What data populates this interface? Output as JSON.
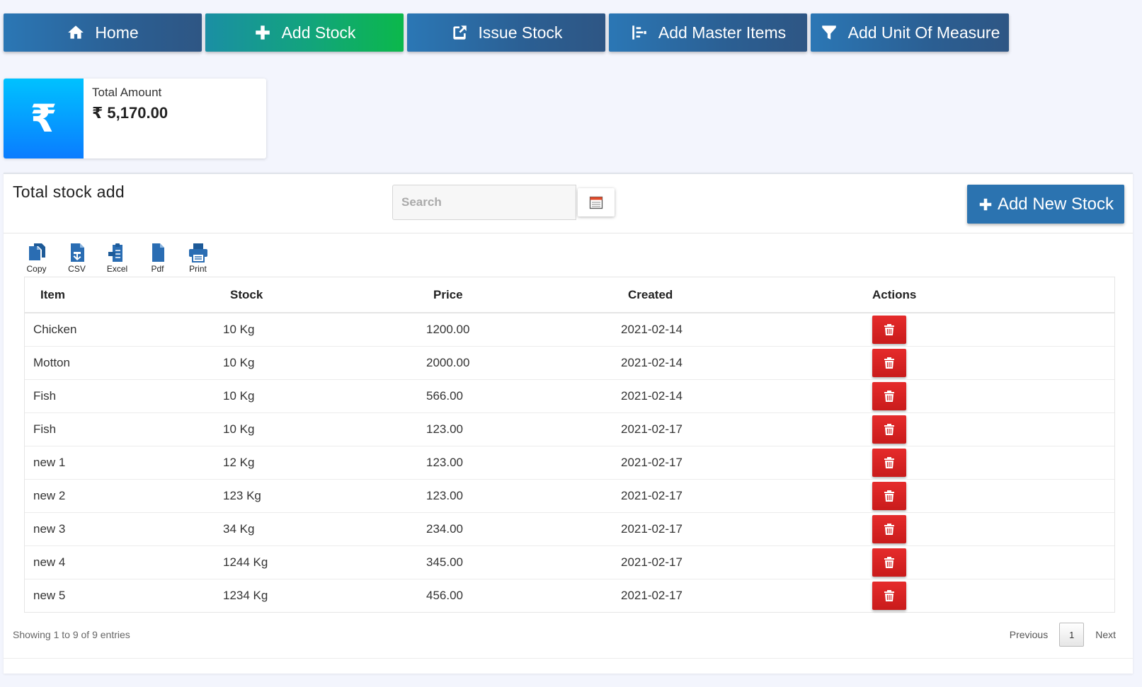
{
  "nav": [
    {
      "label": "Home",
      "icon": "home-icon"
    },
    {
      "label": "Add Stock",
      "icon": "plus-icon",
      "active": true
    },
    {
      "label": "Issue Stock",
      "icon": "share-icon"
    },
    {
      "label": "Add Master Items",
      "icon": "list-icon"
    },
    {
      "label": "Add Unit Of Measure",
      "icon": "filter-icon"
    }
  ],
  "summary": {
    "label": "Total Amount",
    "value": "₹ 5,170.00",
    "currency_symbol": "₹"
  },
  "panel": {
    "title": "Total stock add",
    "search_placeholder": "Search",
    "add_button_label": "Add New Stock"
  },
  "tools": [
    {
      "label": "Copy",
      "icon": "copy-icon"
    },
    {
      "label": "CSV",
      "icon": "csv-icon"
    },
    {
      "label": "Excel",
      "icon": "excel-icon"
    },
    {
      "label": "Pdf",
      "icon": "pdf-icon"
    },
    {
      "label": "Print",
      "icon": "print-icon"
    }
  ],
  "table": {
    "headers": [
      "Item",
      "Stock",
      "Price",
      "Created",
      "Actions"
    ],
    "rows": [
      {
        "item": "Chicken",
        "stock": "10 Kg",
        "price": "1200.00",
        "created": "2021-02-14"
      },
      {
        "item": "Motton",
        "stock": "10 Kg",
        "price": "2000.00",
        "created": "2021-02-14"
      },
      {
        "item": "Fish",
        "stock": "10 Kg",
        "price": "566.00",
        "created": "2021-02-14"
      },
      {
        "item": "Fish",
        "stock": "10 Kg",
        "price": "123.00",
        "created": "2021-02-17"
      },
      {
        "item": "new 1",
        "stock": "12 Kg",
        "price": "123.00",
        "created": "2021-02-17"
      },
      {
        "item": "new 2",
        "stock": "123 Kg",
        "price": "123.00",
        "created": "2021-02-17"
      },
      {
        "item": "new 3",
        "stock": "34 Kg",
        "price": "234.00",
        "created": "2021-02-17"
      },
      {
        "item": "new 4",
        "stock": "1244 Kg",
        "price": "345.00",
        "created": "2021-02-17"
      },
      {
        "item": "new 5",
        "stock": "1234 Kg",
        "price": "456.00",
        "created": "2021-02-17"
      }
    ]
  },
  "footer": {
    "showing": "Showing 1 to 9 of 9 entries",
    "previous": "Previous",
    "page": "1",
    "next": "Next"
  },
  "colors": {
    "nav_bg": "#2b5f93",
    "nav_active": "#0bb84b",
    "amount_icon": "#0a7cff",
    "add_button": "#2b73b0",
    "delete_button": "#d32020",
    "page_bg": "#f3f5fd"
  }
}
